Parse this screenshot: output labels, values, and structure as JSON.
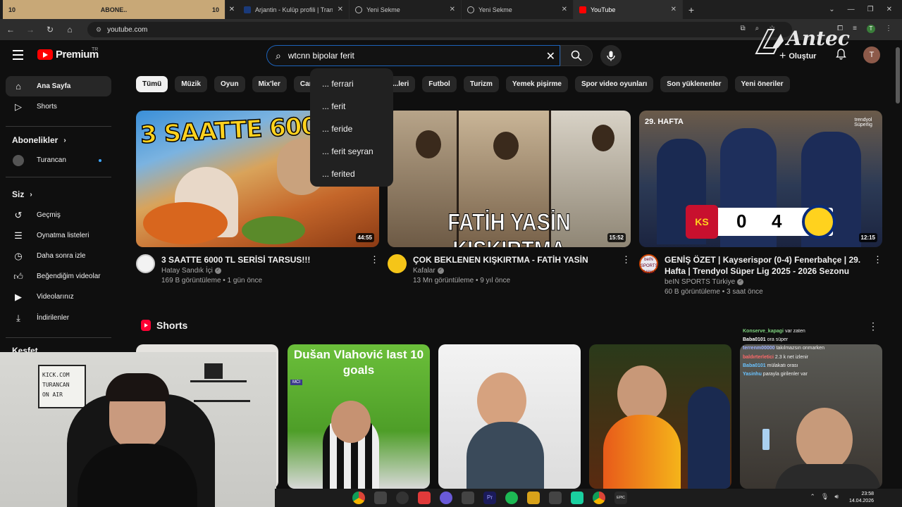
{
  "browser": {
    "tabs": [
      {
        "label": "ABONE..",
        "left_num": "10",
        "right_num": "10",
        "kind": "banner"
      },
      {
        "label": "Arjantin - Kulüp profili | Transfe",
        "kind": "normal"
      },
      {
        "label": "Yeni Sekme",
        "kind": "normal"
      },
      {
        "label": "Yeni Sekme",
        "kind": "normal"
      },
      {
        "label": "YouTube",
        "kind": "active"
      }
    ],
    "new_tab": "+",
    "url": "youtube.com"
  },
  "header": {
    "logo_text": "Premium",
    "logo_country": "TR",
    "search_value": "wtcnn bipolar ferit",
    "create_label": "Oluştur",
    "avatar_letter": "T",
    "overlay_brand": "Antec"
  },
  "suggestions": [
    "... ferrari",
    "... ferit",
    "... feride",
    "... ferit seyran",
    "... ferited"
  ],
  "sidebar": {
    "home": "Ana Sayfa",
    "shorts": "Shorts",
    "subs_heading": "Abonelikler",
    "sub_channel": "Turancan",
    "you_heading": "Siz",
    "you_items": [
      "Geçmiş",
      "Oynatma listeleri",
      "Daha sonra izle",
      "Beğendiğim videolar",
      "Videolarınız",
      "İndirilenler"
    ],
    "explore_heading": "Keşfet"
  },
  "chips": [
    "Tümü",
    "Müzik",
    "Oyun",
    "Mix'ler",
    "Canlı",
    "...leri",
    "Futbol",
    "Turizm",
    "Yemek pişirme",
    "Spor video oyunları",
    "Son yüklenenler",
    "Yeni öneriler"
  ],
  "videos": [
    {
      "title": "3 SAATTE 6000 TL SERİSİ TARSUS!!!",
      "channel": "Hatay Sandık İçi",
      "stats": "169 B görüntüleme • 1 gün önce",
      "duration": "44:55",
      "thumb_text": "3 SAATTE 6000"
    },
    {
      "title": "ÇOK BEKLENEN KIŞKIRTMA - FATİH YASİN",
      "channel": "Kafalar",
      "stats": "13 Mn görüntüleme • 9 yıl önce",
      "duration": "15:52",
      "thumb_text": "FATİH YASİN KIŞKIRTMA"
    },
    {
      "title": "GENİŞ ÖZET | Kayserispor (0-4) Fenerbahçe | 29. Hafta | Trendyol Süper Lig 2025 - 2026 Sezonu",
      "channel": "beIN SPORTS Türkiye",
      "stats": "60 B görüntüleme • 3 saat önce",
      "duration": "12:15",
      "thumb_week": "29. HAFTA",
      "score_home": "0",
      "score_away": "4",
      "league": "trendyol Süperlig"
    }
  ],
  "shorts": {
    "heading": "Shorts",
    "items": [
      {
        "text": ""
      },
      {
        "text": "Dušan Vlahović last 10 goals",
        "badge": "MCI"
      },
      {
        "text": ""
      },
      {
        "text": ""
      },
      {
        "text": ""
      }
    ]
  },
  "chat": [
    {
      "user": "Konserve_kapagi",
      "msg": "var zaten"
    },
    {
      "user": "Baba0101",
      "msg": "ora süper"
    },
    {
      "user": "terrenm00000",
      "msg": "takılmazsın onmarken"
    },
    {
      "user": "baldırterletici",
      "msg": "2.3 k net izlenir"
    },
    {
      "user": "Baba0101",
      "msg": "mülakatı orası"
    },
    {
      "user": "Yasinhu",
      "msg": "parayla girilenler var"
    }
  ],
  "webcam": {
    "board_lines": [
      "KICK.COM",
      "TURANCAN",
      "ON AIR"
    ]
  },
  "taskbar": {
    "time": "23:58",
    "date": "14.04.2026"
  },
  "colors": {
    "bg": "#0f0f0f",
    "accent_red": "#ff0000",
    "search_border": "#1c62b9",
    "chip_bg": "#272727",
    "banner": "#c8a877"
  }
}
